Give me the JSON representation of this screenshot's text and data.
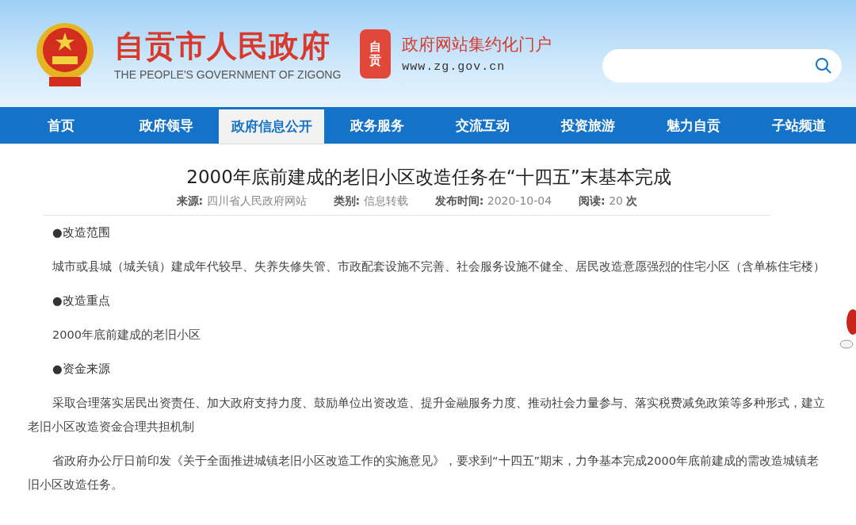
{
  "header": {
    "site_name": "自贡市人民政府",
    "site_name_en": "THE PEOPLE'S GOVERNMENT OF ZIGONG",
    "seal_text": "自贡",
    "portal_title": "政府网站集约化门户",
    "portal_url": "www.zg.gov.cn"
  },
  "nav": [
    {
      "label": "首页",
      "selected": false
    },
    {
      "label": "政府领导",
      "selected": false
    },
    {
      "label": "政府信息公开",
      "selected": true
    },
    {
      "label": "政务服务",
      "selected": false
    },
    {
      "label": "交流互动",
      "selected": false
    },
    {
      "label": "投资旅游",
      "selected": false
    },
    {
      "label": "魅力自贡",
      "selected": false
    },
    {
      "label": "子站频道",
      "selected": false
    }
  ],
  "article": {
    "title": "2000年底前建成的老旧小区改造任务在“十四五”末基本完成",
    "meta": [
      {
        "label": "来源:",
        "value": "四川省人民政府网站"
      },
      {
        "label": "类别:",
        "value": "信息转载"
      },
      {
        "label": "发布时间:",
        "value": "2020-10-04"
      },
      {
        "label": "阅读:",
        "value": "20",
        "unit": "次"
      }
    ],
    "paragraphs": [
      {
        "kind": "heading",
        "text": "●改造范围"
      },
      {
        "kind": "text",
        "text": "城市或县城（城关镇）建成年代较早、失养失修失管、市政配套设施不完善、社会服务设施不健全、居民改造意愿强烈的住宅小区（含单栋住宅楼）"
      },
      {
        "kind": "heading",
        "text": "●改造重点"
      },
      {
        "kind": "text",
        "text": "2000年底前建成的老旧小区"
      },
      {
        "kind": "heading",
        "text": "●资金来源"
      },
      {
        "kind": "text",
        "text": "采取合理落实居民出资责任、加大政府支持力度、鼓励单位出资改造、提升金融服务力度、推动社会力量参与、落实税费减免政策等多种形式，建立老旧小区改造资金合理共担机制"
      },
      {
        "kind": "text",
        "text": "省政府办公厅日前印发《关于全面推进城镇老旧小区改造工作的实施意见》，要求到“十四五”期末，力争基本完成2000年底前建成的需改造城镇老旧小区改造任务。"
      }
    ]
  }
}
